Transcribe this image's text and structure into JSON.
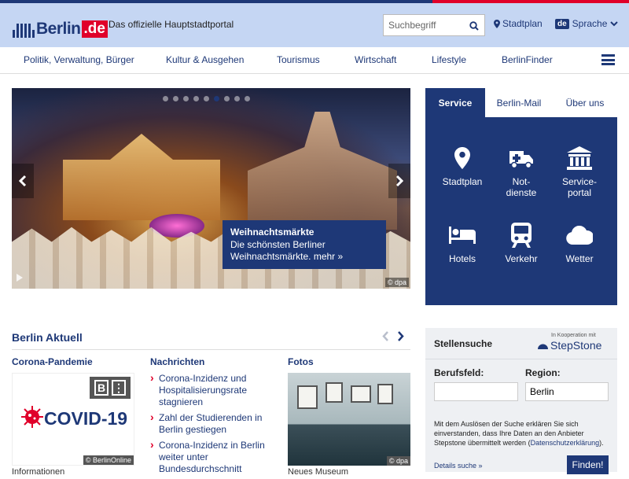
{
  "header": {
    "logo_text": "Berlin",
    "logo_tld": ".de",
    "tagline": "Das offizielle Hauptstadtportal",
    "search_placeholder": "Suchbegriff",
    "stadtplan_label": "Stadtplan",
    "lang_badge": "de",
    "sprache_label": "Sprache"
  },
  "nav": {
    "items": [
      "Politik, Verwaltung, Bürger",
      "Kultur & Ausgehen",
      "Tourismus",
      "Wirtschaft",
      "Lifestyle",
      "BerlinFinder"
    ]
  },
  "hero": {
    "caption_title": "Weihnachtsmärkte",
    "caption_text": "Die schönsten Berliner Weihnachtsmärkte. mehr »",
    "credit": "© dpa",
    "slide_count": 9,
    "active_slide": 6
  },
  "service": {
    "tabs": [
      "Service",
      "Berlin-Mail",
      "Über uns"
    ],
    "items": [
      {
        "label_l1": "Stadtplan",
        "label_l2": "",
        "icon": "map-pin-icon"
      },
      {
        "label_l1": "Not-",
        "label_l2": "dienste",
        "icon": "ambulance-icon"
      },
      {
        "label_l1": "Service-",
        "label_l2": "portal",
        "icon": "building-icon"
      },
      {
        "label_l1": "Hotels",
        "label_l2": "",
        "icon": "bed-icon"
      },
      {
        "label_l1": "Verkehr",
        "label_l2": "",
        "icon": "train-icon"
      },
      {
        "label_l1": "Wetter",
        "label_l2": "",
        "icon": "cloud-icon"
      }
    ]
  },
  "aktuell": {
    "title": "Berlin Aktuell",
    "col1_head": "Corona-Pandemie",
    "covid_word": "COVID-19",
    "covid_credit": "© BerlinOnline",
    "col1_caption": "Informationen",
    "col2_head": "Nachrichten",
    "news": [
      "Corona-Inzidenz und Hospitalisierungsrate stagnieren",
      "Zahl der Studierenden in Berlin gestiegen",
      "Corona-Inzidenz in Berlin weiter unter Bundesdurchschnitt"
    ],
    "col3_head": "Fotos",
    "fotos_credit": "© dpa",
    "col3_caption": "Neues Museum"
  },
  "jobs": {
    "title": "Stellensuche",
    "koop": "In Kooperation mit",
    "partner": "StepStone",
    "berufsfeld_label": "Berufsfeld:",
    "region_label": "Region:",
    "berufsfeld_value": "",
    "region_value": "Berlin",
    "disclaimer": "Mit dem Auslösen der Suche erklären Sie sich einverstanden, dass Ihre Daten an den Anbieter Stepstone übermittelt werden (",
    "disclaimer_link": "Datenschutzerklärung",
    "disclaimer_end": ").",
    "details": "Details suche »",
    "find_button": "Finden!"
  },
  "colors": {
    "brand_blue": "#1e3877",
    "accent_red": "#e0002a",
    "header_bg": "#c5d6f3"
  }
}
